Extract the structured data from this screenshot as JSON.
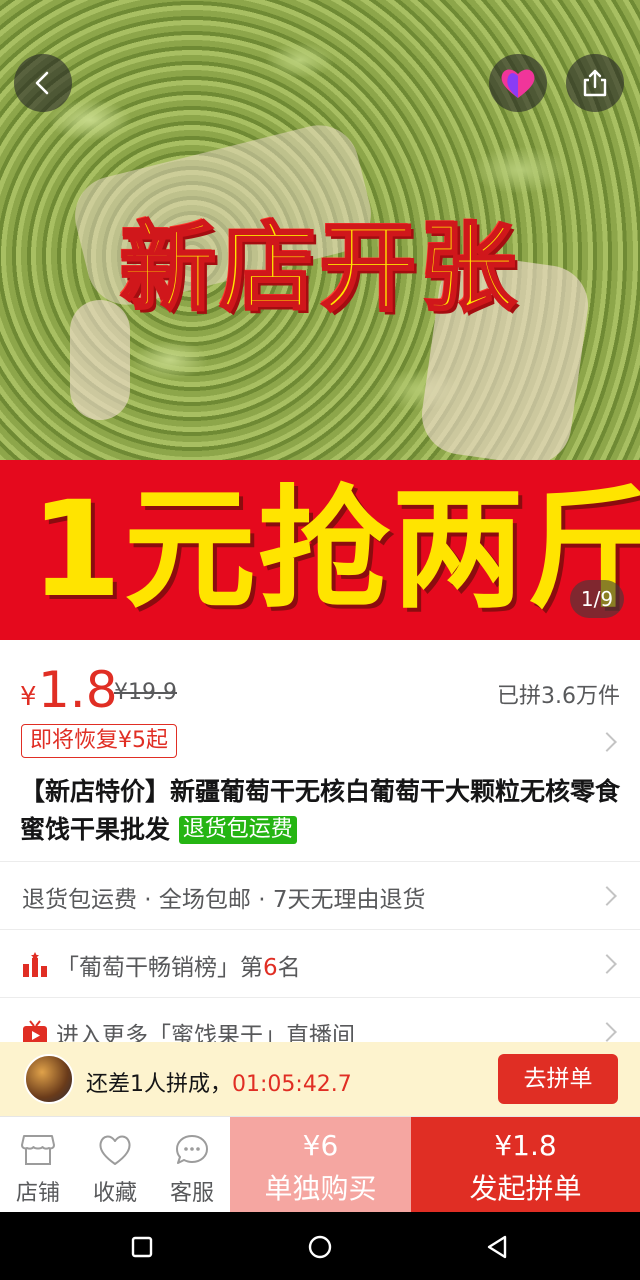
{
  "hero": {
    "headline": "新店开张",
    "banner": "1元抢两斤",
    "counter": "1/9"
  },
  "price": {
    "currency": "¥",
    "current": "1.8",
    "original": "¥19.9",
    "sold": "已拼3.6万件",
    "restore_tag": "即将恢复¥5起"
  },
  "product": {
    "title": "【新店特价】新疆葡萄干无核白葡萄干大颗粒无核零食蜜饯干果批发",
    "return_tag": "退货包运费"
  },
  "services": {
    "text": "退货包运费 · 全场包邮 · 7天无理由退货"
  },
  "ranking": {
    "prefix": "「葡萄干畅销榜」第",
    "rank": "6",
    "suffix": "名"
  },
  "live": {
    "text": "进入更多「蜜饯果干」直播间"
  },
  "group": {
    "text": "还差1人拼成，",
    "timer": "01:05:42.7",
    "button": "去拼单"
  },
  "bottom": {
    "store": "店铺",
    "favorite": "收藏",
    "service": "客服",
    "solo_price": "¥6",
    "solo_label": "单独购买",
    "group_price": "¥1.8",
    "group_label": "发起拼单"
  },
  "colors": {
    "accent": "#e02e24",
    "banner_red": "#e5091d",
    "headline_yellow": "#ffe400",
    "tag_green": "#25b513",
    "group_bar_bg": "#fdf3ce"
  },
  "icons": {
    "back": "back-arrow-icon",
    "favorite_app": "heart-logo-icon",
    "share": "share-icon",
    "store": "store-icon",
    "favorite": "heart-outline-icon",
    "service": "chat-bubble-icon",
    "rank": "rank-chart-icon",
    "live": "live-tv-icon"
  }
}
